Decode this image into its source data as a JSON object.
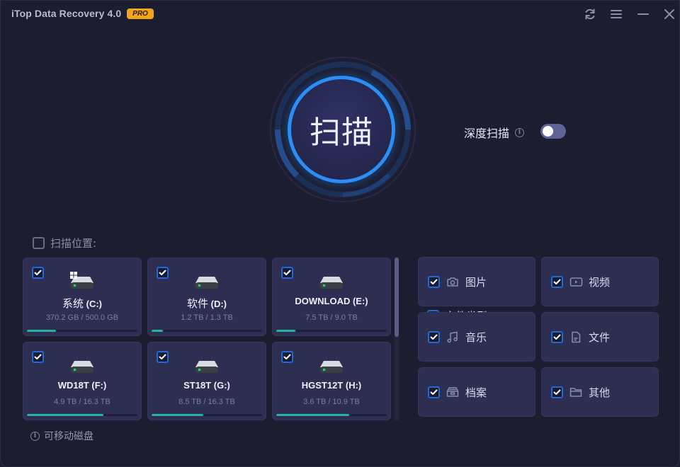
{
  "window": {
    "title": "iTop Data Recovery 4.0",
    "badge": "PRO",
    "controls": [
      {
        "name": "refresh-icon",
        "label": "refresh"
      },
      {
        "name": "menu-icon",
        "label": "menu"
      },
      {
        "name": "minimize-icon",
        "label": "minimize"
      },
      {
        "name": "close-icon",
        "label": "close"
      }
    ]
  },
  "scan": {
    "button_label": "扫描"
  },
  "deep_scan": {
    "label": "深度扫描",
    "info_icon": "info-icon",
    "enabled": false
  },
  "scan_location": {
    "header": "扫描位置:",
    "checked": false,
    "drives": [
      {
        "label_zh": "系统",
        "label": " (C:)",
        "used": "370.2 GB",
        "total": "500.0 GB",
        "size_text": "370.2 GB / 500.0 GB",
        "usage_fraction": 0.26,
        "checked": true,
        "system": true
      },
      {
        "label_zh": "软件",
        "label": " (D:)",
        "used": "1.2 TB",
        "total": "1.3 TB",
        "size_text": "1.2 TB / 1.3 TB",
        "usage_fraction": 0.1,
        "checked": true,
        "system": false
      },
      {
        "label_zh": "",
        "label": "DOWNLOAD (E:)",
        "used": "7.5 TB",
        "total": "9.0 TB",
        "size_text": "7.5 TB / 9.0 TB",
        "usage_fraction": 0.17,
        "checked": true,
        "system": false
      },
      {
        "label_zh": "",
        "label": "WD18T (F:)",
        "used": "4.9 TB",
        "total": "16.3 TB",
        "size_text": "4.9 TB / 16.3 TB",
        "usage_fraction": 0.69,
        "checked": true,
        "system": false
      },
      {
        "label_zh": "",
        "label": "ST18T (G:)",
        "used": "8.5 TB",
        "total": "16.3 TB",
        "size_text": "8.5 TB / 16.3 TB",
        "usage_fraction": 0.47,
        "checked": true,
        "system": false
      },
      {
        "label_zh": "",
        "label": "HGST12T (H:)",
        "used": "3.6 TB",
        "total": "10.9 TB",
        "size_text": "3.6 TB / 10.9 TB",
        "usage_fraction": 0.66,
        "checked": true,
        "system": false
      }
    ],
    "removable_label": "可移动磁盘"
  },
  "file_types": {
    "header": "文件类型:",
    "checked": true,
    "items": [
      {
        "label": "图片",
        "icon": "camera-icon",
        "checked": true
      },
      {
        "label": "视频",
        "icon": "video-icon",
        "checked": true
      },
      {
        "label": "音乐",
        "icon": "music-icon",
        "checked": true
      },
      {
        "label": "文件",
        "icon": "document-icon",
        "checked": true
      },
      {
        "label": "档案",
        "icon": "archive-icon",
        "checked": true
      },
      {
        "label": "其他",
        "icon": "folder-icon",
        "checked": true
      }
    ]
  },
  "colors": {
    "background": "#1c1d31",
    "card": "#2d2e52",
    "accent_blue": "#2c8df5",
    "checkbox_border": "#1f6ad6",
    "usage_bar": "#22b4a0",
    "pro_badge": "#f2a41c"
  }
}
